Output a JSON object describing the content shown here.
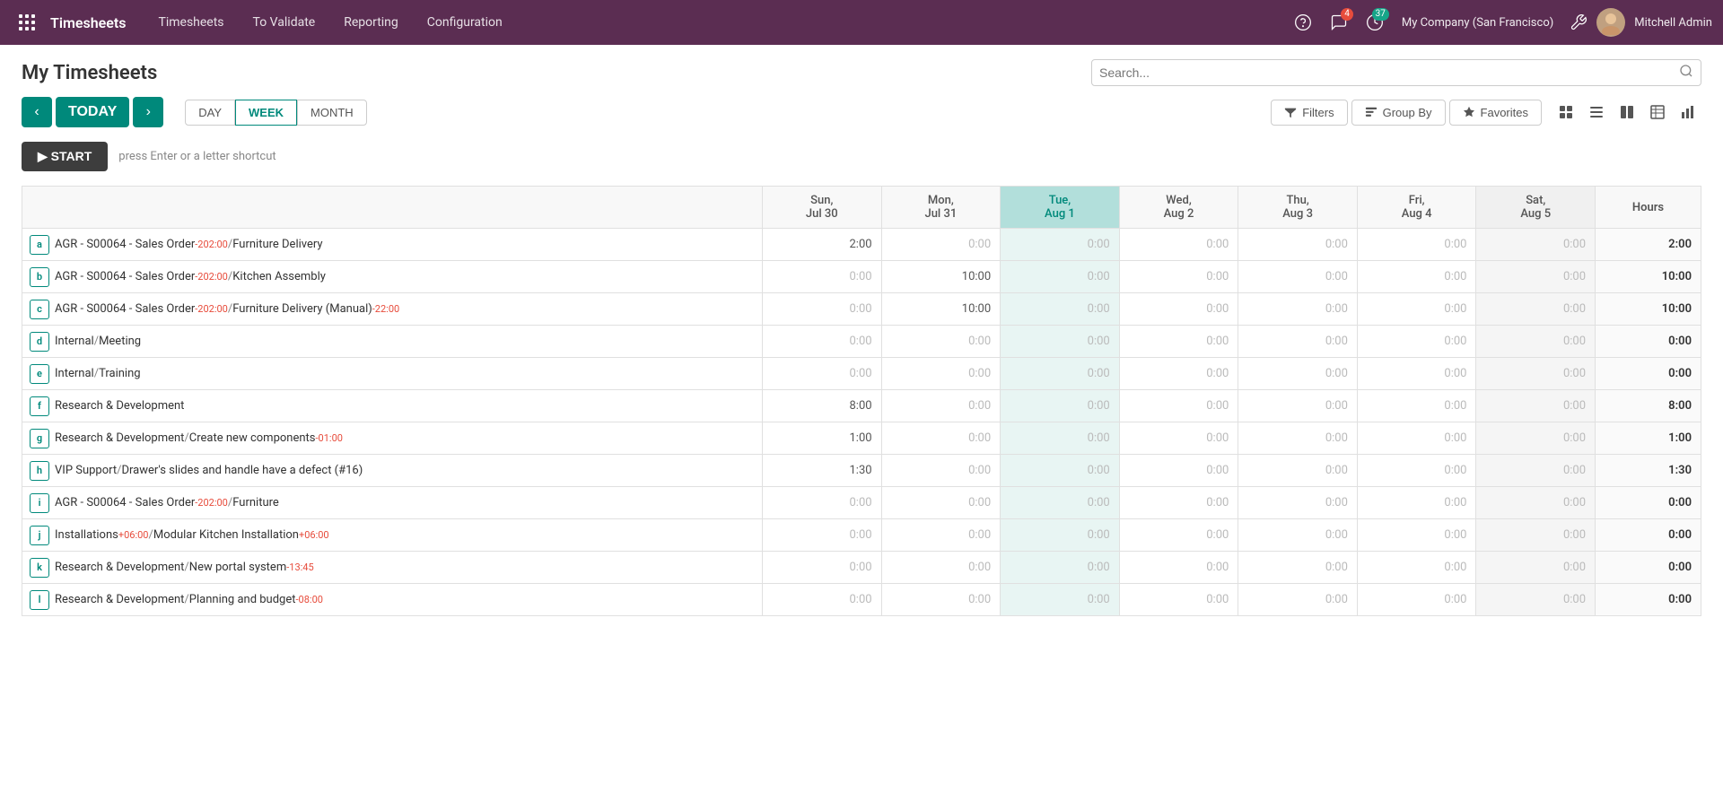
{
  "app": {
    "name": "Timesheets"
  },
  "topnav": {
    "brand": "Timesheets",
    "links": [
      "Timesheets",
      "To Validate",
      "Reporting",
      "Configuration"
    ],
    "chat_badge": "4",
    "activity_badge": "37",
    "company": "My Company (San Francisco)",
    "user": "Mitchell Admin"
  },
  "page": {
    "title": "My Timesheets",
    "search_placeholder": "Search..."
  },
  "controls": {
    "today_label": "TODAY",
    "day_label": "DAY",
    "week_label": "WEEK",
    "month_label": "MONTH",
    "filters_label": "Filters",
    "group_by_label": "Group By",
    "favorites_label": "Favorites"
  },
  "start": {
    "button_label": "▶ START",
    "hint": "press Enter or a letter shortcut"
  },
  "table": {
    "columns": [
      {
        "key": "task",
        "label": "",
        "today": false
      },
      {
        "key": "sun",
        "label": "Sun,\nJul 30",
        "today": false
      },
      {
        "key": "mon",
        "label": "Mon,\nJul 31",
        "today": false
      },
      {
        "key": "tue",
        "label": "Tue,\nAug 1",
        "today": true
      },
      {
        "key": "wed",
        "label": "Wed,\nAug 2",
        "today": false
      },
      {
        "key": "thu",
        "label": "Thu,\nAug 3",
        "today": false
      },
      {
        "key": "fri",
        "label": "Fri,\nAug 4",
        "today": false
      },
      {
        "key": "sat",
        "label": "Sat,\nAug 5",
        "today": false
      },
      {
        "key": "hours",
        "label": "Hours",
        "today": false
      }
    ],
    "rows": [
      {
        "letter": "a",
        "task": "AGR - S00064 - Sales Order",
        "tag": "-202:00",
        "subtask": "Furniture Delivery",
        "sun": "2:00",
        "mon": "0:00",
        "tue": "0:00",
        "wed": "0:00",
        "thu": "0:00",
        "fri": "0:00",
        "sat": "0:00",
        "hours": "2:00"
      },
      {
        "letter": "b",
        "task": "AGR - S00064 - Sales Order",
        "tag": "-202:00",
        "subtask": "Kitchen Assembly",
        "sun": "0:00",
        "mon": "10:00",
        "tue": "0:00",
        "wed": "0:00",
        "thu": "0:00",
        "fri": "0:00",
        "sat": "0:00",
        "hours": "10:00"
      },
      {
        "letter": "c",
        "task": "AGR - S00064 - Sales Order",
        "tag": "-202:00",
        "subtask": "Furniture Delivery (Manual)",
        "subtag": "-22:00",
        "sun": "0:00",
        "mon": "10:00",
        "tue": "0:00",
        "wed": "0:00",
        "thu": "0:00",
        "fri": "0:00",
        "sat": "0:00",
        "hours": "10:00"
      },
      {
        "letter": "d",
        "task": "Internal",
        "subtask": "Meeting",
        "sun": "0:00",
        "mon": "0:00",
        "tue": "0:00",
        "wed": "0:00",
        "thu": "0:00",
        "fri": "0:00",
        "sat": "0:00",
        "hours": "0:00"
      },
      {
        "letter": "e",
        "task": "Internal",
        "subtask": "Training",
        "sun": "0:00",
        "mon": "0:00",
        "tue": "0:00",
        "wed": "0:00",
        "thu": "0:00",
        "fri": "0:00",
        "sat": "0:00",
        "hours": "0:00"
      },
      {
        "letter": "f",
        "task": "Research & Development",
        "subtask": "",
        "sun": "8:00",
        "mon": "0:00",
        "tue": "0:00",
        "wed": "0:00",
        "thu": "0:00",
        "fri": "0:00",
        "sat": "0:00",
        "hours": "8:00"
      },
      {
        "letter": "g",
        "task": "Research & Development",
        "subtask": "Create new components",
        "subtag": "-01:00",
        "sun": "1:00",
        "mon": "0:00",
        "tue": "0:00",
        "wed": "0:00",
        "thu": "0:00",
        "fri": "0:00",
        "sat": "0:00",
        "hours": "1:00"
      },
      {
        "letter": "h",
        "task": "VIP Support",
        "subtask": "Drawer's slides and handle have a defect (#16)",
        "sun": "1:30",
        "mon": "0:00",
        "tue": "0:00",
        "wed": "0:00",
        "thu": "0:00",
        "fri": "0:00",
        "sat": "0:00",
        "hours": "1:30"
      },
      {
        "letter": "i",
        "task": "AGR - S00064 - Sales Order",
        "tag": "-202:00",
        "subtask": "Furniture",
        "sun": "0:00",
        "mon": "0:00",
        "tue": "0:00",
        "wed": "0:00",
        "thu": "0:00",
        "fri": "0:00",
        "sat": "0:00",
        "hours": "0:00"
      },
      {
        "letter": "j",
        "task": "Installations",
        "tag": "+06:00",
        "subtask": "Modular Kitchen Installation",
        "subtag": "+06:00",
        "sun": "0:00",
        "mon": "0:00",
        "tue": "0:00",
        "wed": "0:00",
        "thu": "0:00",
        "fri": "0:00",
        "sat": "0:00",
        "hours": "0:00"
      },
      {
        "letter": "k",
        "task": "Research & Development",
        "subtask": "New portal system",
        "subtag": "-13:45",
        "sun": "0:00",
        "mon": "0:00",
        "tue": "0:00",
        "wed": "0:00",
        "thu": "0:00",
        "fri": "0:00",
        "sat": "0:00",
        "hours": "0:00"
      },
      {
        "letter": "l",
        "task": "Research & Development",
        "subtask": "Planning and budget",
        "subtag": "-08:00",
        "sun": "0:00",
        "mon": "0:00",
        "tue": "0:00",
        "wed": "0:00",
        "thu": "0:00",
        "fri": "0:00",
        "sat": "0:00",
        "hours": "0:00"
      }
    ]
  }
}
